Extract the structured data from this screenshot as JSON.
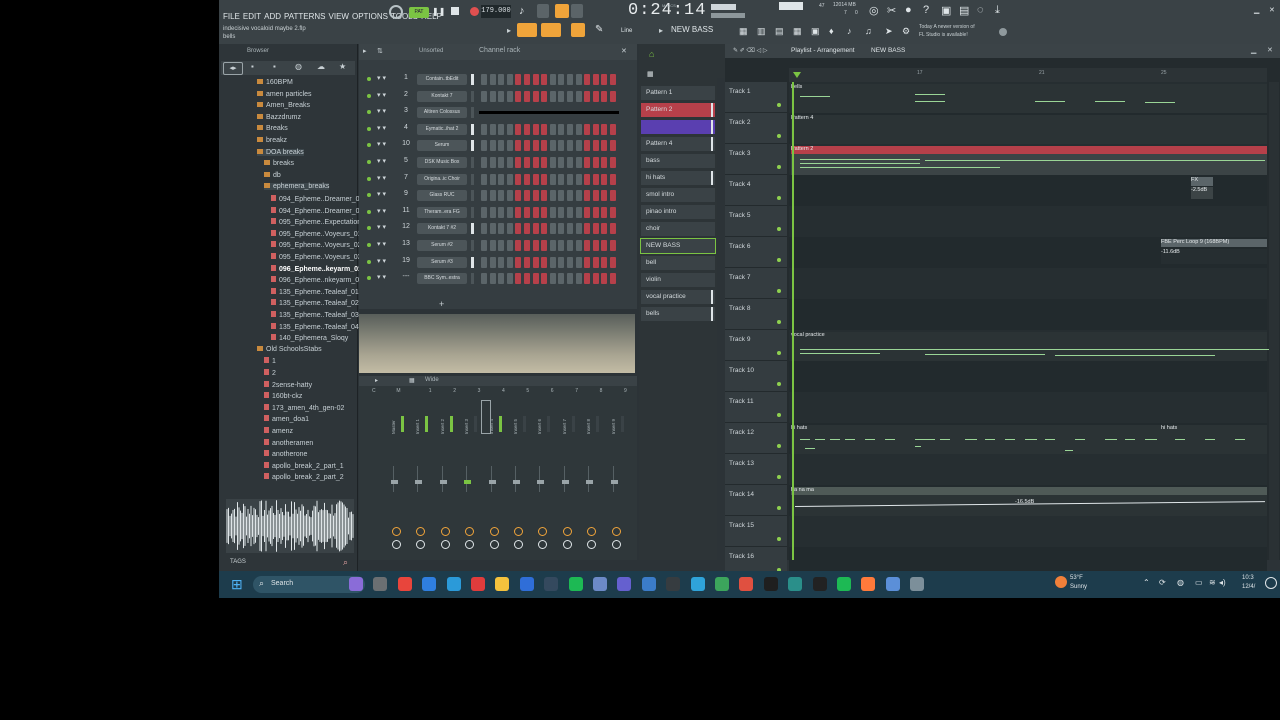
{
  "menu": [
    "FILE",
    "EDIT",
    "ADD",
    "PATTERNS",
    "VIEW",
    "OPTIONS",
    "TOOLS",
    "HELP"
  ],
  "project": {
    "title": "indecisive vocaloid maybe 2.flp",
    "subtitle": "bells"
  },
  "transport": {
    "bpm": "179.000",
    "time": "0:24:14",
    "time_small": "M:S:CS",
    "pattern": "NEW BASS",
    "line": "Line",
    "cpu": "47",
    "mem": "12014 MB",
    "mem2": "7",
    "mem3": "0"
  },
  "news": {
    "line1": "Today  A newer version of",
    "line2": "FL Studio is available!"
  },
  "browser": {
    "title": "Browser",
    "items": [
      {
        "label": "160BPM",
        "type": "folder",
        "indent": 0
      },
      {
        "label": "amen particles",
        "type": "folder",
        "indent": 0
      },
      {
        "label": "Amen_Breaks",
        "type": "folder",
        "indent": 0
      },
      {
        "label": "Bazzdrumz",
        "type": "folder",
        "indent": 0
      },
      {
        "label": "Breaks",
        "type": "folder",
        "indent": 0
      },
      {
        "label": "breakz",
        "type": "folder",
        "indent": 0
      },
      {
        "label": "DOA breaks",
        "type": "folder",
        "indent": 0
      },
      {
        "label": "breaks",
        "type": "folder",
        "indent": 1
      },
      {
        "label": "db",
        "type": "folder",
        "indent": 1
      },
      {
        "label": "ephemera_breaks",
        "type": "folder",
        "indent": 1
      },
      {
        "label": "094_Epheme..Dreamer_01",
        "type": "file",
        "indent": 2
      },
      {
        "label": "094_Epheme..Dreamer_02",
        "type": "file",
        "indent": 2
      },
      {
        "label": "095_Epheme..Expectation",
        "type": "file",
        "indent": 2
      },
      {
        "label": "095_Epheme..Voyeurs_01",
        "type": "file",
        "indent": 2
      },
      {
        "label": "095_Epheme..Voyeurs_02",
        "type": "file",
        "indent": 2
      },
      {
        "label": "095_Epheme..Voyeurs_03",
        "type": "file",
        "indent": 2
      },
      {
        "label": "096_Epheme..keyarm_01",
        "type": "file",
        "indent": 2
      },
      {
        "label": "096_Epheme..nkeyarm_02",
        "type": "file",
        "indent": 2
      },
      {
        "label": "135_Epheme..Tealeaf_01",
        "type": "file",
        "indent": 2
      },
      {
        "label": "135_Epheme..Tealeaf_02",
        "type": "file",
        "indent": 2
      },
      {
        "label": "135_Epheme..Tealeaf_03",
        "type": "file",
        "indent": 2
      },
      {
        "label": "135_Epheme..Tealeaf_04",
        "type": "file",
        "indent": 2
      },
      {
        "label": "140_Ephemera_Sloqy",
        "type": "file",
        "indent": 2
      },
      {
        "label": "Old SchoolsStabs",
        "type": "folder",
        "indent": 0
      },
      {
        "label": "1",
        "type": "file",
        "indent": 1
      },
      {
        "label": "2",
        "type": "file",
        "indent": 1
      },
      {
        "label": "2sense-hatty",
        "type": "file",
        "indent": 1
      },
      {
        "label": "160bt-ckz",
        "type": "file",
        "indent": 1
      },
      {
        "label": "173_amen_4th_gen-02",
        "type": "file",
        "indent": 1
      },
      {
        "label": "amen_doa1",
        "type": "file",
        "indent": 1
      },
      {
        "label": "amenz",
        "type": "file",
        "indent": 1
      },
      {
        "label": "anotheramen",
        "type": "file",
        "indent": 1
      },
      {
        "label": "anotherone",
        "type": "file",
        "indent": 1
      },
      {
        "label": "apollo_break_2_part_1",
        "type": "file",
        "indent": 1
      },
      {
        "label": "apollo_break_2_part_2",
        "type": "file",
        "indent": 1
      }
    ],
    "tags": "TAGS"
  },
  "rack": {
    "filter": "Unsorted",
    "title": "Channel rack",
    "channels": [
      {
        "num": "1",
        "name": "Contain..tbEdit"
      },
      {
        "num": "2",
        "name": "Kontakt 7"
      },
      {
        "num": "3",
        "name": "Altiren Colossus"
      },
      {
        "num": "4",
        "name": "Eymatic..ihat 2"
      },
      {
        "num": "10",
        "name": "Serum"
      },
      {
        "num": "5",
        "name": "DSK Music Box"
      },
      {
        "num": "7",
        "name": "Origina..ic Choir"
      },
      {
        "num": "9",
        "name": "Glass RUC"
      },
      {
        "num": "11",
        "name": "Theram..era FG"
      },
      {
        "num": "12",
        "name": "Kontakt 7 #2"
      },
      {
        "num": "13",
        "name": "Serum #2"
      },
      {
        "num": "19",
        "name": "Serum #3"
      },
      {
        "num": "---",
        "name": "BBC Sym..estra"
      }
    ]
  },
  "mixer": {
    "view": "Wide",
    "tracks": [
      "C",
      "M",
      "1",
      "2",
      "3",
      "4",
      "5",
      "6",
      "7",
      "8",
      "9"
    ],
    "strips": [
      "Master",
      "Insert 1",
      "Insert 2",
      "Insert 3",
      "Insert 4",
      "Insert 5",
      "Insert 6",
      "Insert 7",
      "Insert 8",
      "Insert 9"
    ]
  },
  "patterns": [
    "Pattern 1",
    "Pattern 2",
    "",
    "Pattern 4",
    "bass",
    "hi hats",
    "smol intro",
    "pinao intro",
    "choir",
    "NEW BASS",
    "bell",
    "violin",
    "vocal practice",
    "bells"
  ],
  "playlist": {
    "title": "Playlist - Arrangement",
    "pattern": "NEW BASS",
    "ruler": [
      "17",
      "21",
      "25"
    ],
    "tracks": [
      "Track 1",
      "Track 2",
      "Track 3",
      "Track 4",
      "Track 5",
      "Track 6",
      "Track 7",
      "Track 8",
      "Track 9",
      "Track 10",
      "Track 11",
      "Track 12",
      "Track 13",
      "Track 14",
      "Track 15",
      "Track 16"
    ],
    "clips": {
      "bells": "bells",
      "pattern4": "Pattern 4",
      "pattern2": "Pattern 2",
      "fx": "FX",
      "perc": "FBE Perc Loop 9 (168BPM)",
      "perc_db": "-11.6dB",
      "vocal": "vocal practice",
      "hihats": "hi hats",
      "hihats2": "hi hats",
      "track14": "ha na ma",
      "track14_db": "-16.5dB",
      "track4_db": "-2.5dB"
    }
  },
  "taskbar": {
    "search": "Search",
    "weather_temp": "53°F",
    "weather_desc": "Sunny",
    "time": "10:3",
    "date": "12/4/"
  },
  "colors": {
    "accent_green": "#7bc443",
    "pattern_red": "#b6404a",
    "clip_grey": "#4f5a57",
    "taskbar": "#1d3c4c"
  }
}
